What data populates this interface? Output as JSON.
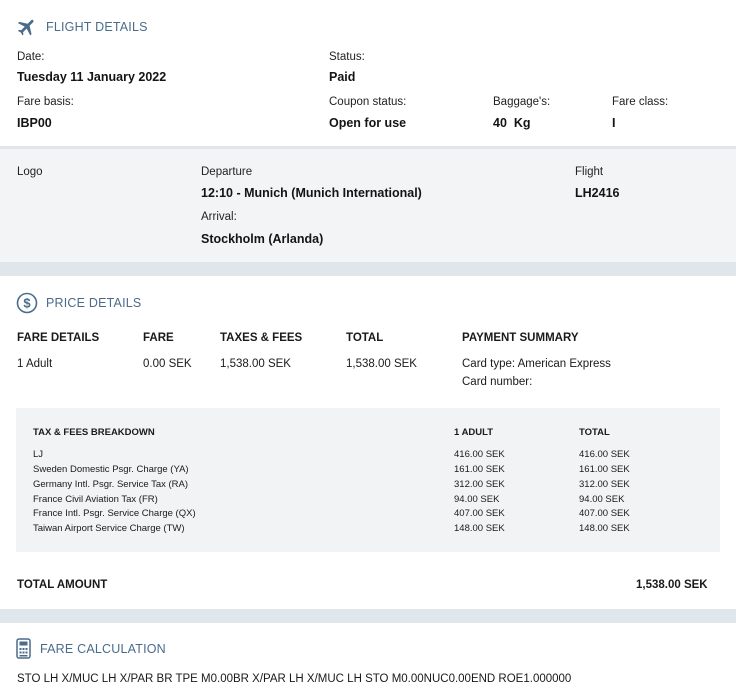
{
  "flight_details": {
    "title": "FLIGHT DETAILS",
    "date_label": "Date:",
    "date_value": "Tuesday 11 January 2022",
    "status_label": "Status:",
    "status_value": "Paid",
    "fare_basis_label": "Fare basis:",
    "fare_basis_value": "IBP00",
    "coupon_status_label": "Coupon status:",
    "coupon_status_value": "Open for use",
    "baggage_label": "Baggage's:",
    "baggage_value": "40  Kg",
    "fare_class_label": "Fare class:",
    "fare_class_value": "I"
  },
  "segment": {
    "logo_label": "Logo",
    "departure_label": "Departure",
    "departure_value": "12:10 - Munich (Munich International)",
    "arrival_label": "Arrival:",
    "arrival_value": "Stockholm (Arlanda)",
    "flight_label": "Flight",
    "flight_value": "LH2416"
  },
  "price_details": {
    "title": "PRICE DETAILS",
    "headers": {
      "fare_details": "FARE DETAILS",
      "fare": "FARE",
      "taxes_fees": "TAXES & FEES",
      "total": "TOTAL",
      "payment_summary": "PAYMENT SUMMARY"
    },
    "row": {
      "passenger": "1 Adult",
      "fare": "0.00 SEK",
      "taxes_fees": "1,538.00 SEK",
      "total": "1,538.00 SEK"
    },
    "payment": {
      "card_type": "Card type: American Express",
      "card_number": "Card number:"
    },
    "breakdown": {
      "title": "TAX & FEES BREAKDOWN",
      "col_adult": "1 ADULT",
      "col_total": "TOTAL",
      "rows": [
        {
          "name": "LJ",
          "adult": "416.00 SEK",
          "total": "416.00 SEK"
        },
        {
          "name": "Sweden Domestic Psgr. Charge (YA)",
          "adult": "161.00 SEK",
          "total": "161.00 SEK"
        },
        {
          "name": "Germany Intl. Psgr. Service Tax (RA)",
          "adult": "312.00 SEK",
          "total": "312.00 SEK"
        },
        {
          "name": "France Civil Aviation Tax (FR)",
          "adult": "94.00 SEK",
          "total": "94.00 SEK"
        },
        {
          "name": "France Intl. Psgr. Service Charge (QX)",
          "adult": "407.00 SEK",
          "total": "407.00 SEK"
        },
        {
          "name": "Taiwan Airport Service Charge (TW)",
          "adult": "148.00 SEK",
          "total": "148.00 SEK"
        }
      ]
    },
    "total_amount_label": "TOTAL AMOUNT",
    "total_amount_value": "1,538.00 SEK"
  },
  "fare_calculation": {
    "title": "FARE CALCULATION",
    "text": "STO LH X/MUC LH X/PAR BR TPE M0.00BR X/PAR LH X/MUC LH STO M0.00NUC0.00END ROE1.000000"
  },
  "colors": {
    "accent": "#4a6c8c",
    "page_bg": "#dfe6ec",
    "segment_bg": "#f3f4f5",
    "breakdown_bg": "#f2f3f4"
  },
  "icons": [
    "airplane-icon",
    "dollar-circle-icon",
    "calculator-icon"
  ]
}
